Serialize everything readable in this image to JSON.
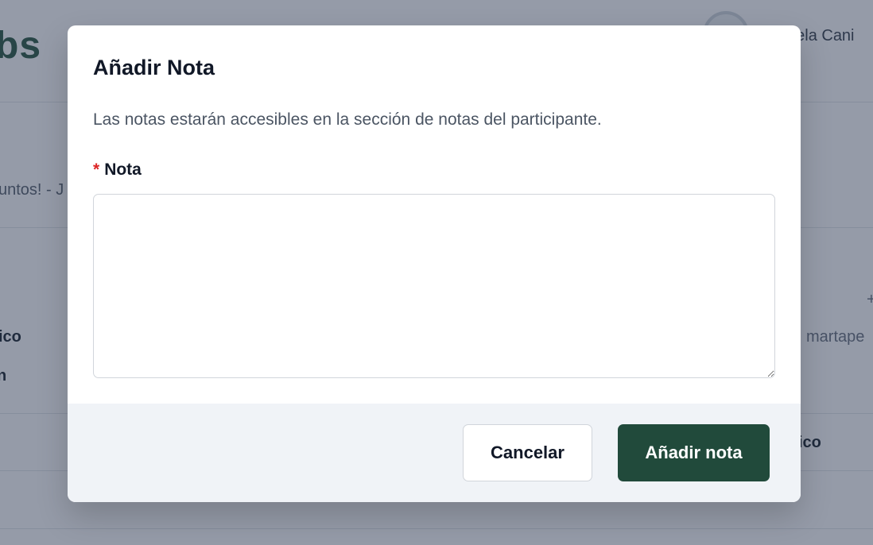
{
  "background": {
    "logo_text": "bs",
    "user_name": "uela Cani",
    "subtitle_fragment": "untos! - J",
    "left_col_1": "ico",
    "left_col_2": "n",
    "right_col_1": "martape",
    "right_col_2": "ico",
    "plus_mark": "+"
  },
  "modal": {
    "title": "Añadir Nota",
    "description": "Las notas estarán accesibles en la sección de notas del participante.",
    "field": {
      "required_marker": "*",
      "label": "Nota",
      "value": "",
      "placeholder": ""
    },
    "footer": {
      "cancel_label": "Cancelar",
      "submit_label": "Añadir nota"
    }
  },
  "colors": {
    "primary": "#214a3b",
    "required": "#dc2626",
    "overlay": "#212e4a"
  }
}
